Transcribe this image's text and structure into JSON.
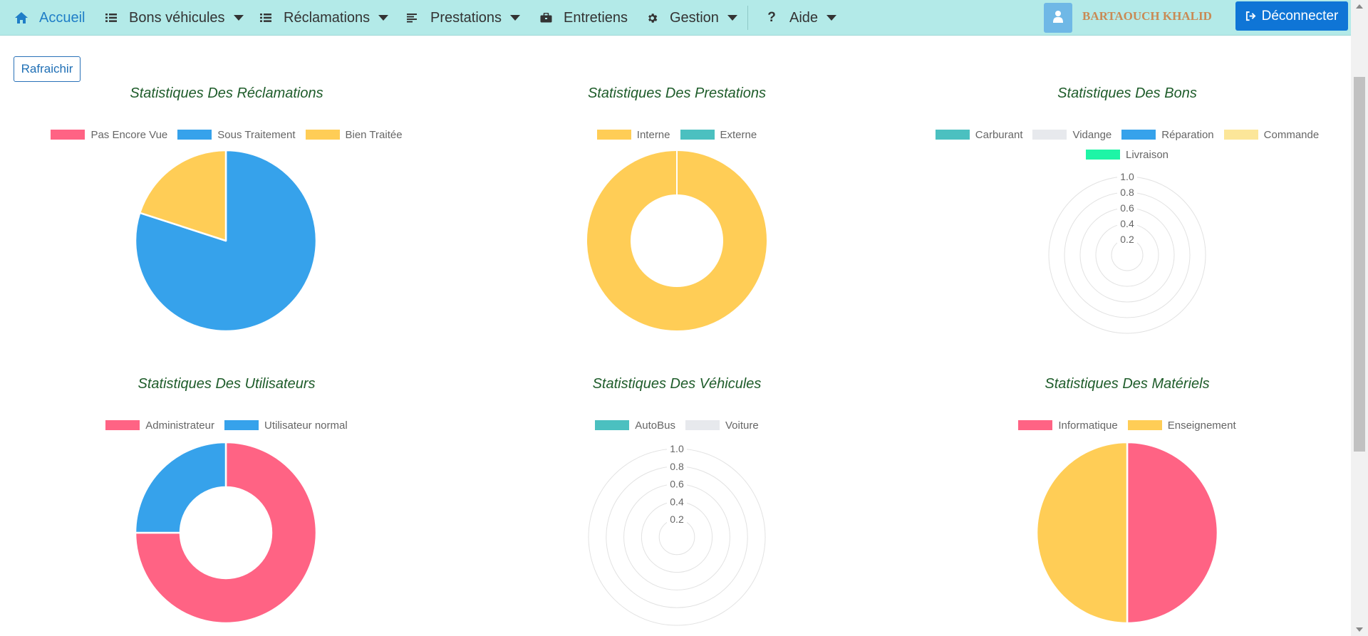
{
  "nav": {
    "items": [
      {
        "label": "Accueil",
        "icon": "home-icon",
        "dropdown": false,
        "active": true
      },
      {
        "label": "Bons véhicules",
        "icon": "list-icon",
        "dropdown": true
      },
      {
        "label": "Réclamations",
        "icon": "list-icon",
        "dropdown": true
      },
      {
        "label": "Prestations",
        "icon": "align-left-icon",
        "dropdown": true
      },
      {
        "label": "Entretiens",
        "icon": "briefcase-icon",
        "dropdown": false
      },
      {
        "label": "Gestion",
        "icon": "gear-icon",
        "dropdown": true
      },
      {
        "label": "Aide",
        "icon": "question-icon",
        "dropdown": true
      }
    ],
    "user_name": "BARTAOUCH KHALID",
    "logout_label": "Déconnecter"
  },
  "toolbar": {
    "refresh_label": "Rafraichir"
  },
  "colors": {
    "navbar": "#b3eae8",
    "title": "#1e5c2a",
    "pink": "#ff6384",
    "blue": "#36a2eb",
    "yellow": "#ffcd56",
    "teal": "#4bc0c0",
    "lightgray": "#e7e9ed",
    "lightyellow": "#fce699",
    "mint": "#1ef5a6"
  },
  "chart_data": [
    {
      "type": "pie",
      "title": "Statistiques Des Réclamations",
      "labels": [
        "Pas Encore Vue",
        "Sous Traitement",
        "Bien Traitée"
      ],
      "colors": [
        "#ff6384",
        "#36a2eb",
        "#ffcd56"
      ],
      "values": [
        0,
        8,
        2
      ],
      "legend": "top"
    },
    {
      "type": "doughnut",
      "title": "Statistiques Des Prestations",
      "labels": [
        "Interne",
        "Externe"
      ],
      "colors": [
        "#ffcd56",
        "#4bc0c0"
      ],
      "values": [
        1,
        0
      ],
      "legend": "top"
    },
    {
      "type": "polarArea",
      "title": "Statistiques Des Bons",
      "labels": [
        "Carburant",
        "Vidange",
        "Réparation",
        "Commande",
        "Livraison"
      ],
      "colors": [
        "#4bc0c0",
        "#e7e9ed",
        "#36a2eb",
        "#fce699",
        "#1ef5a6"
      ],
      "values": [
        0,
        0,
        0,
        0,
        0
      ],
      "ticks": [
        "0.2",
        "0.4",
        "0.6",
        "0.8",
        "1.0"
      ],
      "rlim": [
        0,
        1
      ],
      "legend": "top"
    },
    {
      "type": "doughnut",
      "title": "Statistiques Des Utilisateurs",
      "labels": [
        "Administrateur",
        "Utilisateur normal"
      ],
      "colors": [
        "#ff6384",
        "#36a2eb"
      ],
      "values": [
        3,
        1
      ],
      "legend": "top"
    },
    {
      "type": "polarArea",
      "title": "Statistiques Des Véhicules",
      "labels": [
        "AutoBus",
        "Voiture"
      ],
      "colors": [
        "#4bc0c0",
        "#e7e9ed"
      ],
      "values": [
        0,
        0
      ],
      "ticks": [
        "0.2",
        "0.4",
        "0.6",
        "0.8",
        "1.0"
      ],
      "rlim": [
        0,
        1
      ],
      "legend": "top"
    },
    {
      "type": "pie",
      "title": "Statistiques Des Matériels",
      "labels": [
        "Informatique",
        "Enseignement"
      ],
      "colors": [
        "#ff6384",
        "#ffcd56"
      ],
      "values": [
        1,
        1
      ],
      "legend": "top"
    }
  ]
}
